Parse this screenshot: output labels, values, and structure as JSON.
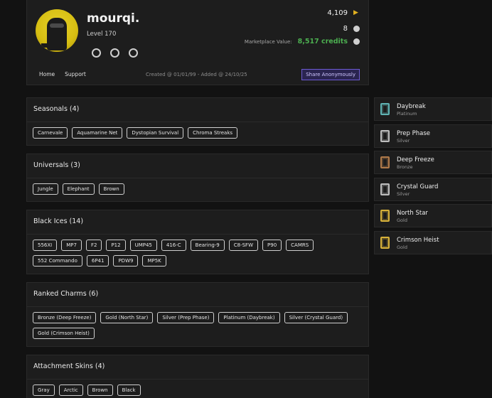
{
  "profile": {
    "username": "mourqi.",
    "level": "Level 170",
    "stat1": "4,109",
    "stat2": "8",
    "marketplace_label": "Marketplace Value:",
    "marketplace_value": "8,517 credits",
    "nav_home": "Home",
    "nav_support": "Support",
    "created": "Created @ 01/01/99 - Added @ 24/10/25",
    "share_label": "Share Anonymously"
  },
  "sections": [
    {
      "title": "Seasonals (4)",
      "items": [
        "Carnevale",
        "Aquamarine Net",
        "Dystopian Survival",
        "Chroma Streaks"
      ]
    },
    {
      "title": "Universals (3)",
      "items": [
        "Jungle",
        "Elephant",
        "Brown"
      ]
    },
    {
      "title": "Black Ices (14)",
      "items": [
        "556XI",
        "MP7",
        "F2",
        "P12",
        "UMP45",
        "416-C",
        "Bearing-9",
        "C8-SFW",
        "P90",
        "CAMRS",
        "552 Commando",
        "6P41",
        "PDW9",
        "MP5K"
      ]
    },
    {
      "title": "Ranked Charms (6)",
      "items": [
        "Bronze (Deep Freeze)",
        "Gold (North Star)",
        "Silver (Prep Phase)",
        "Platinum (Daybreak)",
        "Silver (Crystal Guard)",
        "Gold (Crimson Heist)"
      ]
    },
    {
      "title": "Attachment Skins (4)",
      "items": [
        "Gray",
        "Arctic",
        "Brown",
        "Black"
      ]
    }
  ],
  "charms": [
    {
      "name": "Daybreak",
      "rank": "Platinum",
      "color": "#5fb3b3"
    },
    {
      "name": "Prep Phase",
      "rank": "Silver",
      "color": "#bdbdbd"
    },
    {
      "name": "Deep Freeze",
      "rank": "Bronze",
      "color": "#b07a4a"
    },
    {
      "name": "Crystal Guard",
      "rank": "Silver",
      "color": "#bdbdbd"
    },
    {
      "name": "North Star",
      "rank": "Gold",
      "color": "#d8b23a"
    },
    {
      "name": "Crimson Heist",
      "rank": "Gold",
      "color": "#d8b23a"
    }
  ]
}
